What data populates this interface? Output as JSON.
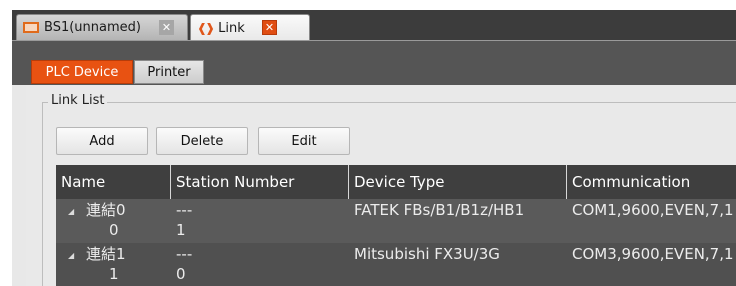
{
  "document_tabs": [
    {
      "label": "BS1(unnamed)",
      "close": "✕",
      "active": false
    },
    {
      "label": "Link",
      "close": "✕",
      "active": true
    }
  ],
  "sub_tabs": [
    {
      "label": "PLC Device",
      "selected": true
    },
    {
      "label": "Printer",
      "selected": false
    }
  ],
  "link_list": {
    "group_label": "Link List",
    "buttons": {
      "add": "Add",
      "delete": "Delete",
      "edit": "Edit"
    },
    "columns": [
      "Name",
      "Station Number",
      "Device Type",
      "Communication"
    ],
    "rows": [
      {
        "name": "連結0",
        "index": "0",
        "station": "---",
        "station_number": "1",
        "device_type": "FATEK FBs/B1/B1z/HB1",
        "communication": "COM1,9600,EVEN,7,1"
      },
      {
        "name": "連結1",
        "index": "1",
        "station": "---",
        "station_number": "0",
        "device_type": "Mitsubishi FX3U/3G",
        "communication": "COM3,9600,EVEN,7,1"
      }
    ]
  },
  "colors": {
    "accent_orange": "#e85212",
    "header_bg": "#3f3f3f",
    "grid_bg": "#555555",
    "panel_bg": "#e9e9e9"
  },
  "icons": {
    "bs_tab_icon": "window-icon",
    "link_tab_icon": "link-icon",
    "row_expander": "expand-triangle-icon"
  }
}
